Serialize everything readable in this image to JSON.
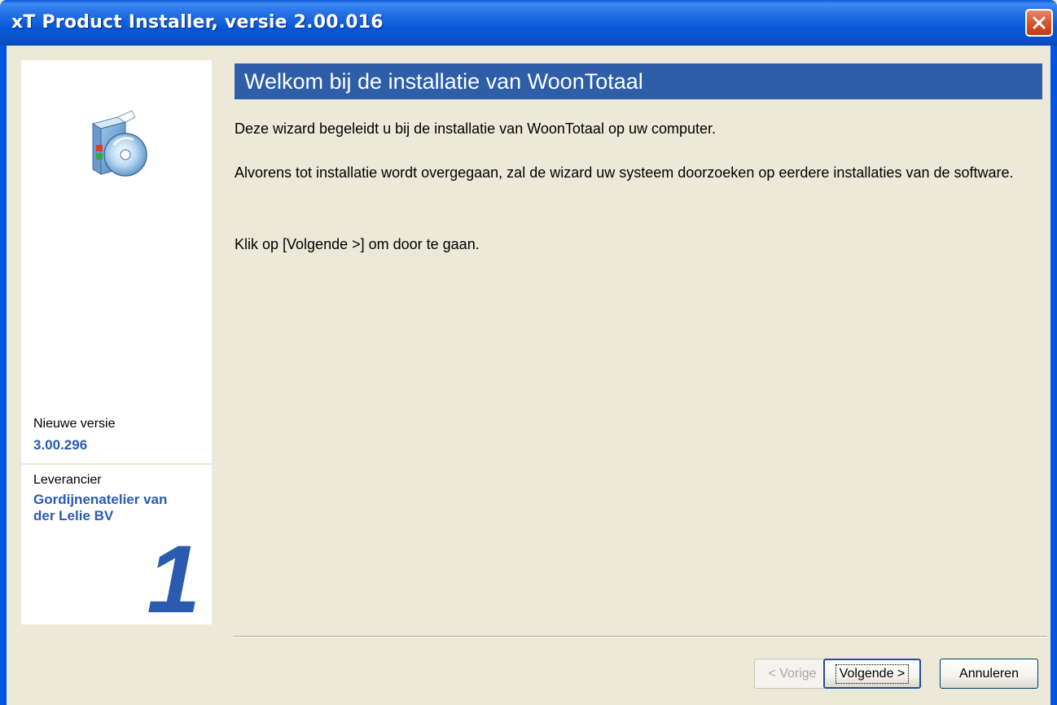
{
  "window": {
    "title": "xT Product Installer, versie 2.00.016"
  },
  "side_panel": {
    "new_version_label": "Nieuwe versie",
    "new_version_value": "3.00.296",
    "supplier_label": "Leverancier",
    "supplier_value_line1": "Gordijnenatelier van",
    "supplier_value_line2": "der Lelie BV",
    "step_number": "1"
  },
  "main": {
    "heading": "Welkom bij de installatie van WoonTotaal",
    "paragraph1": "Deze wizard begeleidt u bij de installatie van WoonTotaal op uw computer.",
    "paragraph2": "Alvorens tot installatie wordt overgegaan, zal de wizard uw systeem doorzoeken op eerdere installaties van de software.",
    "paragraph3": "Klik op [Volgende >] om door te gaan."
  },
  "buttons": {
    "back_label": "< Vorige",
    "next_label": "Volgende >",
    "cancel_label": "Annuleren"
  },
  "icons": {
    "close": "close-icon",
    "installer": "installer-box-cd-icon"
  },
  "colors": {
    "title_bar": "#0a5ad6",
    "banner": "#2e5ea8",
    "accent_text": "#2a5bb0",
    "close_button": "#d9522b",
    "dialog_bg": "#ece9d8"
  }
}
